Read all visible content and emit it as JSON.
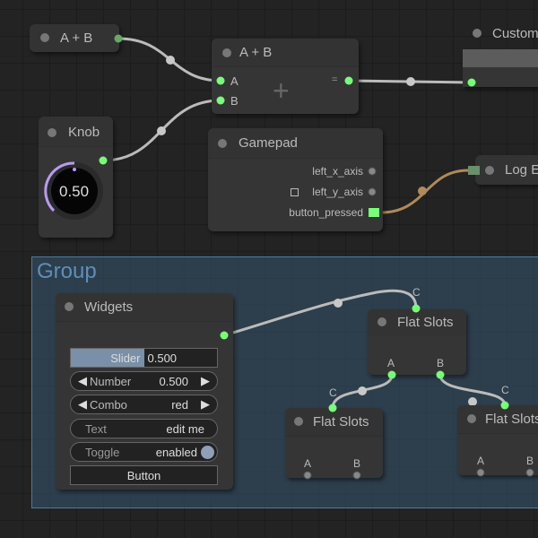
{
  "group": {
    "title": "Group"
  },
  "nodes": {
    "sum_collapsed": {
      "title": "A + B"
    },
    "sum": {
      "title": "A + B",
      "inputs": [
        "A",
        "B"
      ],
      "output": "=",
      "symbol": "+"
    },
    "custom": {
      "title": "Custom"
    },
    "knob": {
      "title": "Knob",
      "value": "0.50",
      "fraction": 0.5
    },
    "gamepad": {
      "title": "Gamepad",
      "outputs": [
        "left_x_axis",
        "left_y_axis",
        "button_pressed"
      ]
    },
    "log": {
      "title": "Log E"
    },
    "widgets": {
      "title": "Widgets",
      "slider": {
        "label": "Slider",
        "value": "0.500",
        "fraction": 0.5
      },
      "number": {
        "label": "Number",
        "value": "0.500"
      },
      "combo": {
        "label": "Combo",
        "value": "red"
      },
      "text": {
        "label": "Text",
        "value": "edit me"
      },
      "toggle": {
        "label": "Toggle",
        "value": "enabled"
      },
      "button": {
        "label": "Button"
      }
    },
    "flat1": {
      "title": "Flat Slots",
      "input": "C",
      "outputs": [
        "A",
        "B"
      ]
    },
    "flat2": {
      "title": "Flat Slots",
      "input": "C",
      "outputs": [
        "A",
        "B"
      ]
    },
    "flat3": {
      "title": "Flat Slots",
      "input": "C",
      "outputs": [
        "A",
        "B"
      ]
    }
  },
  "colors": {
    "slot_on": "#77ff77",
    "link": "#b8b8b8",
    "link_event": "#b08a5a",
    "group": "#5d8fb8",
    "knob_arc": "#b99bf0"
  }
}
